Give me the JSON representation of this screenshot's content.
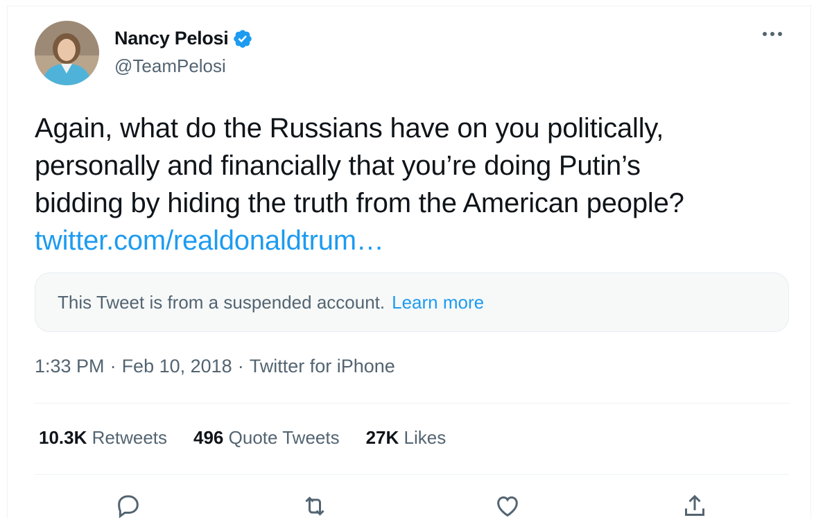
{
  "author": {
    "name": "Nancy Pelosi",
    "handle": "@TeamPelosi",
    "verified": true
  },
  "tweet": {
    "lines": [
      "Again, what do the Russians have on you politically,",
      "personally and financially that you’re doing Putin’s",
      "bidding by hiding the truth from the American people?"
    ],
    "link_text": "twitter.com/realdonaldtrum…"
  },
  "notice": {
    "text": "This Tweet is from a suspended account.",
    "learn_more": "Learn more"
  },
  "meta": {
    "time": "1:33 PM",
    "sep1": "·",
    "date": "Feb 10, 2018",
    "sep2": "·",
    "source": "Twitter for iPhone"
  },
  "stats": {
    "retweets": {
      "count": "10.3K",
      "label": "Retweets"
    },
    "quotes": {
      "count": "496",
      "label": "Quote Tweets"
    },
    "likes": {
      "count": "27K",
      "label": "Likes"
    }
  },
  "icons": {
    "verified": "verified-badge-icon",
    "more": "more-horizontal-icon",
    "reply": "reply-icon",
    "retweet": "retweet-icon",
    "like": "heart-icon",
    "share": "share-icon"
  },
  "colors": {
    "accent": "#1d9bf0",
    "secondary_text": "#536471",
    "notice_bg": "#f7f9f9"
  }
}
